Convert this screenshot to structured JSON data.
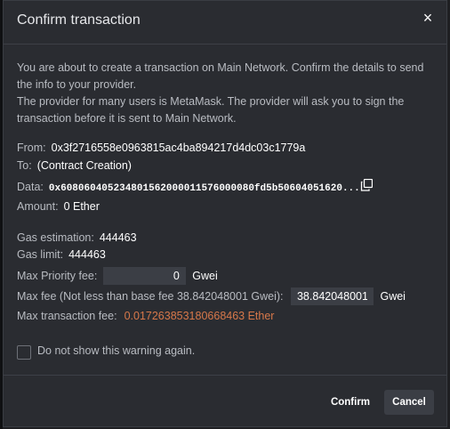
{
  "dialog": {
    "title": "Confirm transaction",
    "close_glyph": "×"
  },
  "intro": {
    "line1": "You are about to create a transaction on Main Network. Confirm the details to send the info to your provider.",
    "line2": "The provider for many users is MetaMask. The provider will ask you to sign the transaction before it is sent to Main Network."
  },
  "tx": {
    "from_label": "From:",
    "from_value": "0x3f2716558e0963815ac4ba894217d4dc03c1779a",
    "to_label": "To:",
    "to_value": "(Contract Creation)",
    "data_label": "Data:",
    "data_value": "0x608060405234801562000011576000080fd5b50604051620...",
    "amount_label": "Amount:",
    "amount_value": "0 Ether"
  },
  "gas": {
    "estimation_label": "Gas estimation:",
    "estimation_value": "444463",
    "limit_label": "Gas limit:",
    "limit_value": "444463",
    "priority_label": "Max Priority fee:",
    "priority_value": "0",
    "priority_unit": "Gwei",
    "maxfee_label": "Max fee (Not less than base fee 38.842048001 Gwei):",
    "maxfee_value": "38.842048001",
    "maxfee_unit": "Gwei",
    "txfee_label": "Max transaction fee:",
    "txfee_value": "0.017263853180668463 Ether"
  },
  "warning_checkbox": {
    "label": "Do not show this warning again.",
    "checked": false
  },
  "buttons": {
    "confirm": "Confirm",
    "cancel": "Cancel"
  },
  "icons": {
    "copy": "copy-icon",
    "close": "close-icon"
  },
  "colors": {
    "background": "#2a2c31",
    "accent_fee": "#d7784a",
    "input_bg": "#3b3e45"
  }
}
